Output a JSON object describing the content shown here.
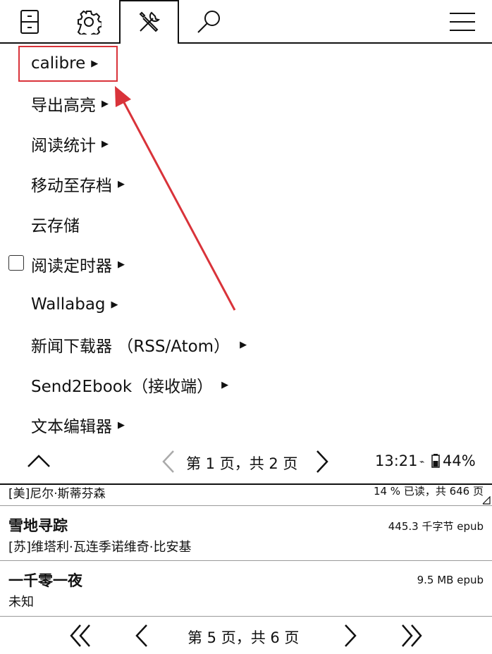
{
  "toolbar": {
    "icons": [
      "file-browser-icon",
      "settings-gear-icon",
      "tools-icon",
      "search-icon",
      "hamburger-menu-icon"
    ],
    "active_tab": "tools-icon"
  },
  "menu": {
    "items": [
      {
        "label": "calibre",
        "has_submenu": true,
        "highlighted": true
      },
      {
        "label": "导出高亮",
        "has_submenu": true
      },
      {
        "label": "阅读统计",
        "has_submenu": true
      },
      {
        "label": "移动至存档",
        "has_submenu": true
      },
      {
        "label": "云存储",
        "has_submenu": false
      },
      {
        "label": "阅读定时器",
        "has_submenu": true,
        "checkbox": true,
        "checked": false
      },
      {
        "label": "Wallabag",
        "has_submenu": true
      },
      {
        "label": "新闻下载器 （RSS/Atom）",
        "has_submenu": true
      },
      {
        "label": "Send2Ebook（接收端）",
        "has_submenu": true
      },
      {
        "label": "文本编辑器",
        "has_submenu": true
      }
    ],
    "footer": {
      "page_label": "第 1 页，共 2 页",
      "time": "13:21",
      "battery": "44%"
    }
  },
  "books": {
    "partial_row": {
      "author": "[美]尼尔·斯蒂芬森",
      "meta": "14 % 已读，共 646 页"
    },
    "rows": [
      {
        "title": "雪地寻踪",
        "author": "[苏]维塔利·瓦连季诺维奇·比安基",
        "meta": "445.3 千字节  epub"
      },
      {
        "title": "一千零一夜",
        "author": "未知",
        "meta": "9.5 MB  epub"
      }
    ],
    "page_label": "第 5 页，共 6 页"
  },
  "annotation": {
    "color": "#d9333a",
    "arrow_direction": "points to calibre"
  }
}
